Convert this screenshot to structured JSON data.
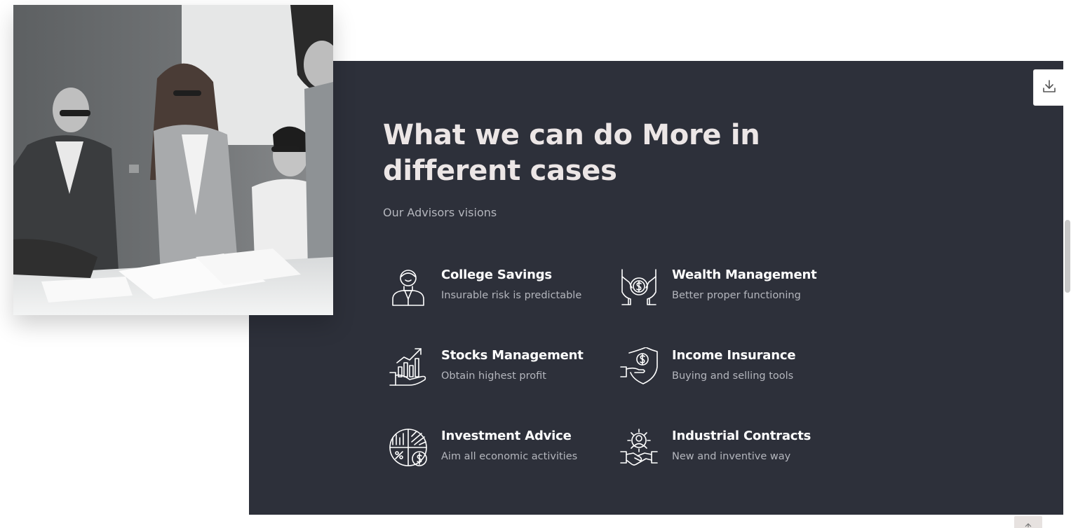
{
  "section": {
    "heading": "What we can do More in different cases",
    "subtitle": "Our Advisors visions"
  },
  "services": [
    {
      "icon": "advisor-person-icon",
      "title": "College Savings",
      "description": "Insurable risk is predictable"
    },
    {
      "icon": "money-hands-icon",
      "title": "Wealth Management",
      "description": "Better proper functioning"
    },
    {
      "icon": "stocks-growth-icon",
      "title": "Stocks Management",
      "description": "Obtain highest profit"
    },
    {
      "icon": "shield-dollar-icon",
      "title": "Income Insurance",
      "description": "Buying and selling tools"
    },
    {
      "icon": "pie-chart-icon",
      "title": "Investment Advice",
      "description": "Aim all economic activities"
    },
    {
      "icon": "handshake-gear-icon",
      "title": "Industrial Contracts",
      "description": "New and inventive way"
    }
  ],
  "colors": {
    "panel_bg": "#2d303a",
    "heading": "#ece6e6",
    "muted_text": "#b4b6bd",
    "white": "#ffffff"
  }
}
